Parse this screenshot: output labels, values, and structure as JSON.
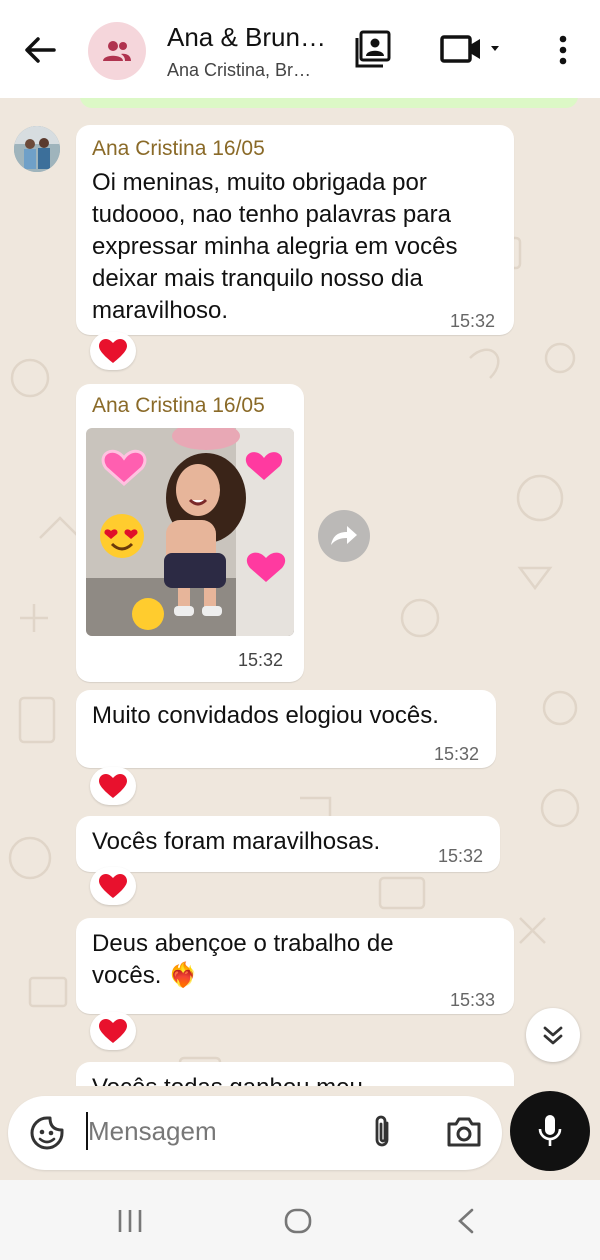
{
  "header": {
    "title": "Ana & Brun…",
    "subtitle": "Ana Cristina, Br…",
    "icons": [
      "back-arrow-icon",
      "group-icon",
      "contact-card-icon",
      "video-call-icon",
      "more-vert-icon"
    ]
  },
  "messages": [
    {
      "sender": "Ana Cristina 16/05",
      "lines": [
        "Oi meninas, muito obrigada por",
        "tudoooo, nao tenho palavras para",
        "expressar minha alegria em vocês",
        "deixar mais tranquilo nosso dia",
        "maravilhoso."
      ],
      "time": "15:32",
      "reaction": "❤️"
    },
    {
      "sender": "Ana Cristina 16/05",
      "image": "photo of smiling child with heart stickers",
      "time": "15:32"
    },
    {
      "lines": [
        "Muito convidados elogiou vocês."
      ],
      "time": "15:32",
      "reaction": "❤️"
    },
    {
      "lines": [
        "Vocês foram maravilhosas."
      ],
      "time": "15:32",
      "reaction": "❤️"
    },
    {
      "lines": [
        "Deus abençoe o trabalho de",
        "vocês. ❤️‍🔥"
      ],
      "time": "15:33",
      "reaction": "❤️"
    },
    {
      "lines": [
        "Vocês todas ganhou meu"
      ]
    }
  ],
  "composer": {
    "placeholder": "Mensagem"
  },
  "colors": {
    "chat_bg": "#efe7dd",
    "sender_name": "#8a6a28",
    "outgoing_bubble": "#dcf8c6",
    "mic_button": "#111111"
  }
}
